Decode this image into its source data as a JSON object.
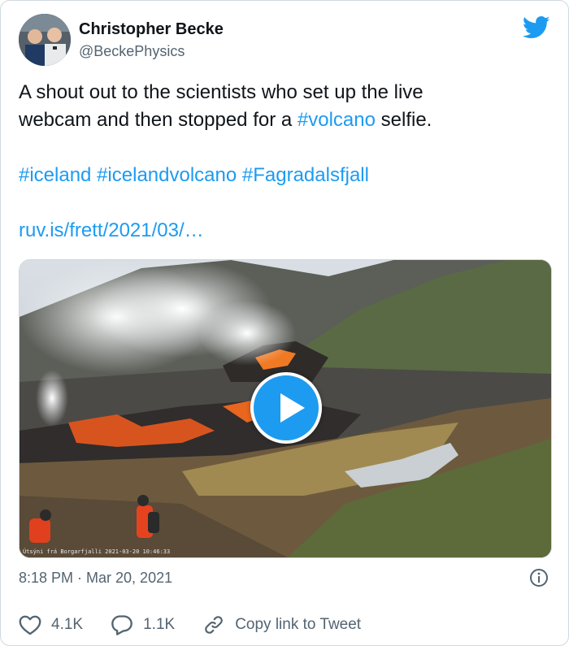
{
  "author": {
    "name": "Christopher Becke",
    "handle": "@BeckePhysics"
  },
  "tweet": {
    "line1": "A shout out to the scientists who set up the live",
    "line2_prefix": "webcam and then stopped for a ",
    "line2_hashtag": "#volcano",
    "line2_suffix": " selfie.",
    "hashtags": [
      "#iceland",
      "#icelandvolcano",
      "#Fagradalsfjall"
    ],
    "link": "ruv.is/frett/2021/03/…"
  },
  "media": {
    "overlay_text": "Útsýni frá Borgarfjalli 2021-03-20 10:46:33"
  },
  "timestamp": "8:18 PM · Mar 20, 2021",
  "actions": {
    "likes": "4.1K",
    "replies": "1.1K",
    "copy_link": "Copy link to Tweet"
  },
  "colors": {
    "accent": "#1d9bf0",
    "text": "#0f1419",
    "muted": "#536471",
    "border": "#cfd9de"
  },
  "icons": [
    "twitter-bird-icon",
    "play-icon",
    "info-icon",
    "heart-icon",
    "reply-icon",
    "link-icon"
  ]
}
